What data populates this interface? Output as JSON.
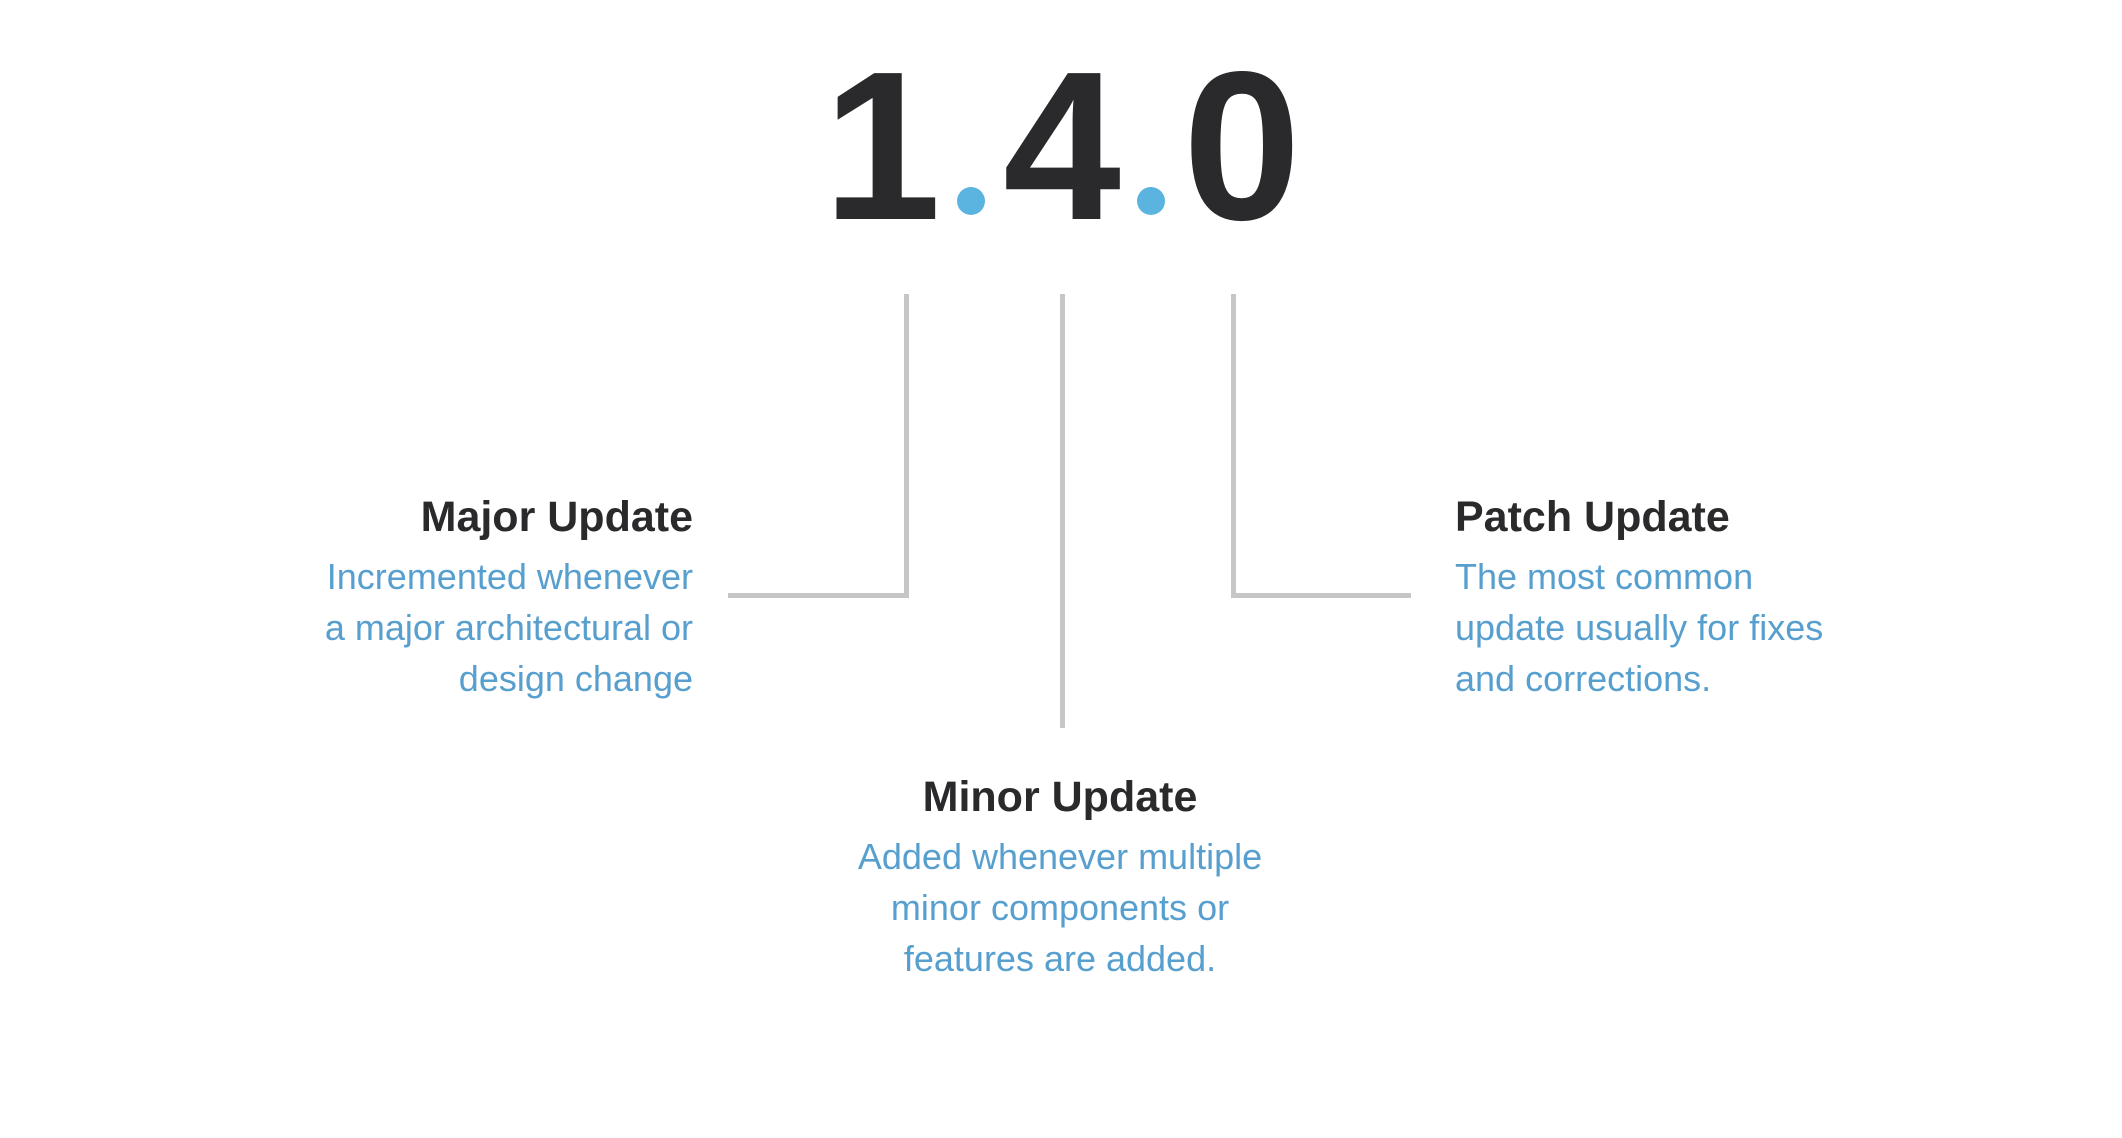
{
  "page": {
    "background_color": "#ffffff",
    "accent_color": "#5bb4e0",
    "body_text_color": "#579fce",
    "heading_text_color": "#2a2a2c",
    "connector_color": "#c6c6c6"
  },
  "version": {
    "full": "1.4.0",
    "major": "1",
    "minor": "4",
    "patch": "0",
    "separator_1": "dot-separator-icon",
    "separator_2": "dot-separator-icon"
  },
  "callouts": [
    {
      "id": "major",
      "title": "Major Update",
      "lines": [
        "Incremented whenever",
        "a major architectural or",
        "design change"
      ],
      "text": "Incremented whenever a major architectural or design change",
      "align": "right"
    },
    {
      "id": "minor",
      "title": "Minor Update",
      "lines": [
        "Added whenever multiple",
        "minor components or",
        "features are added."
      ],
      "text": "Added whenever multiple minor components or features are added.",
      "align": "center"
    },
    {
      "id": "patch",
      "title": "Patch Update",
      "lines": [
        "The most common",
        "update usually for fixes",
        "and corrections."
      ],
      "text": "The most common update usually for fixes and corrections.",
      "align": "left"
    }
  ]
}
